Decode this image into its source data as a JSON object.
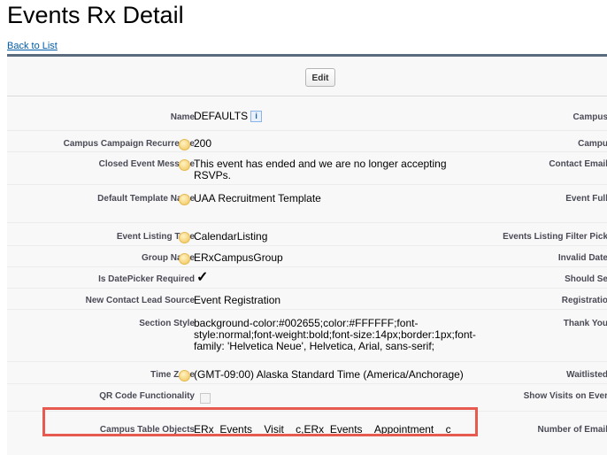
{
  "page": {
    "title": "Events Rx Detail",
    "back_link": "Back to List",
    "edit_button": "Edit"
  },
  "fields": [
    {
      "label": "Name",
      "value": "DEFAULTS",
      "has_help": false,
      "info_icon": "i"
    },
    {
      "label": "Campus Campaign Recurrence",
      "value": "200",
      "has_help": true
    },
    {
      "label": "Closed Event Message",
      "value": "This event has ended and we are no longer accepting RSVPs.",
      "has_help": true
    },
    {
      "label": "Default Template Name",
      "value": "UAA Recruitment Template",
      "has_help": true
    },
    {
      "label": "Event Listing Type",
      "value": "CalendarListing",
      "has_help": true
    },
    {
      "label": "Group Name",
      "value": "ERxCampusGroup",
      "has_help": true
    },
    {
      "label": "Is DatePicker Required",
      "value": "✓",
      "has_help": false
    },
    {
      "label": "New Contact Lead Source",
      "value": "Event Registration",
      "has_help": false
    },
    {
      "label": "Section Style",
      "value": "background-color:#002655;color:#FFFFFF;font-style:normal;font-weight:bold;font-size:14px;border:1px;font-family: 'Helvetica Neue', Helvetica, Arial, sans-serif;",
      "has_help": false
    },
    {
      "label": "Time Zone",
      "value": "(GMT-09:00) Alaska Standard Time (America/Anchorage)",
      "has_help": true
    },
    {
      "label": "QR Code Functionality",
      "value": "",
      "has_help": false
    },
    {
      "label": "Campus Table Objects",
      "value": "ERx_Events__Visit__c,ERx_Events__Appointment__c",
      "has_help": false
    }
  ],
  "right_labels": [
    "Campus",
    "Campu",
    "Contact Email",
    "Event Full",
    "Events Listing Filter Pick",
    "Invalid Date",
    "Should Se",
    "Registratio",
    "Thank You",
    "Waitlisted",
    "Show Visits on Ever",
    "Number of Email"
  ],
  "colors": {
    "link": "#015ba7",
    "panel_border": "#5a6b7d",
    "highlight": "#e65a4f",
    "label": "#4a4a56"
  }
}
